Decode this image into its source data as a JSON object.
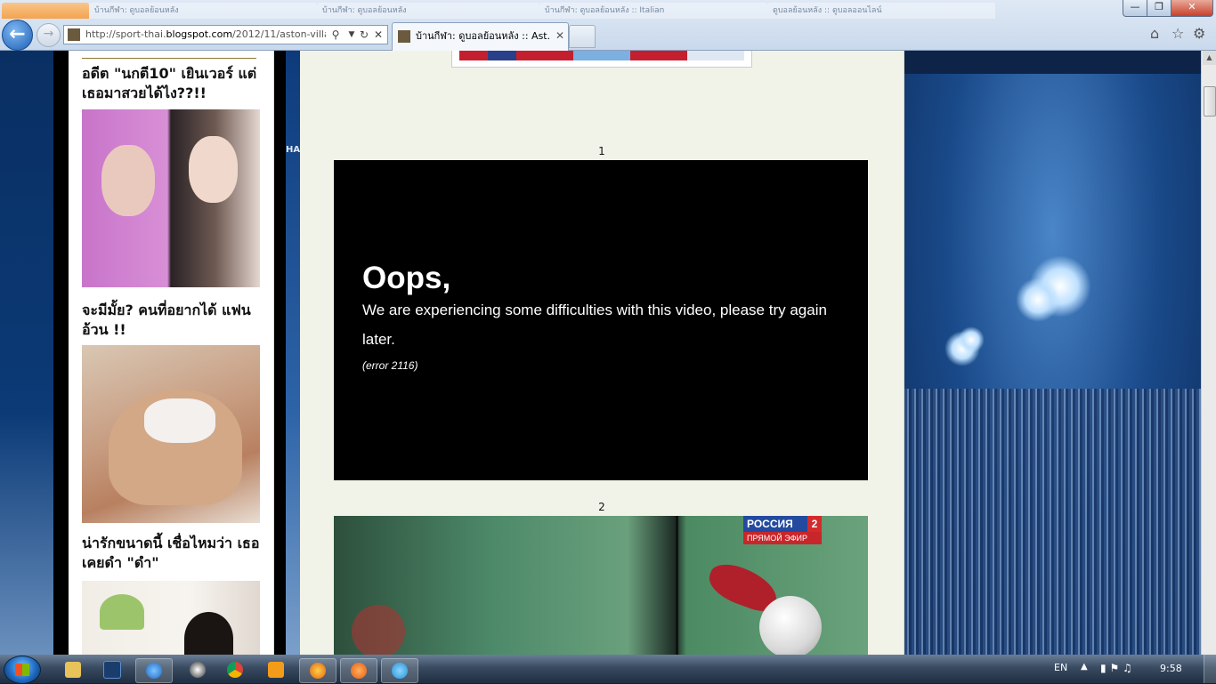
{
  "browser": {
    "background_tabs": [
      {
        "label": ""
      },
      {
        "label": "บ้านกีฬา: ดูบอลย้อนหลัง"
      },
      {
        "label": "บ้านกีฬา: ดูบอลย้อนหลัง"
      },
      {
        "label": "บ้านกีฬา: ดูบอลย้อนหลัง :: Italian"
      },
      {
        "label": "ดูบอลย้อนหลัง :: ดูบอลออนไลน์"
      }
    ],
    "address": {
      "prefix": "http://sport-thai.",
      "domain": "blogspot.com",
      "path": "/2012/11/aston-villa"
    },
    "active_tab": {
      "title": "บ้านกีฬา: ดูบอลย้อนหลัง :: Ast...",
      "close": "✕"
    },
    "window_buttons": {
      "minimize": "—",
      "maximize": "❐",
      "close": "✕"
    },
    "back_icon": "back-arrow-icon",
    "forward_icon": "forward-arrow-icon"
  },
  "sidebar": {
    "items": [
      {
        "title": "อดีต \"นกตี10\" เยินเวอร์ แต่เธอมาสวยได้ไง??!!"
      },
      {
        "title": "จะมีมั้ย? คนที่อยากได้ แฟนอ้วน !!"
      },
      {
        "title": "น่ารักขนาดนี้ เชื่อไหมว่า เธอเคยดำ \"ดำ\""
      }
    ]
  },
  "content": {
    "videos": [
      {
        "number": "1",
        "error_title": "Oops,",
        "error_message": "We are experiencing some difficulties with this video, please try again later.",
        "error_code": "(error 2116)"
      },
      {
        "number": "2",
        "channel": "РОССИЯ",
        "channel_number": "2",
        "channel_sub": "ПРЯМОЙ ЭФИР"
      }
    ],
    "ucl_fragment": "HA"
  },
  "taskbar": {
    "language": "EN",
    "time": "9:58",
    "pinned": [
      "explorer",
      "photoshop",
      "internet-explorer",
      "media-player",
      "chrome",
      "media-center",
      "firefox",
      "ubuntu",
      "skype"
    ]
  }
}
